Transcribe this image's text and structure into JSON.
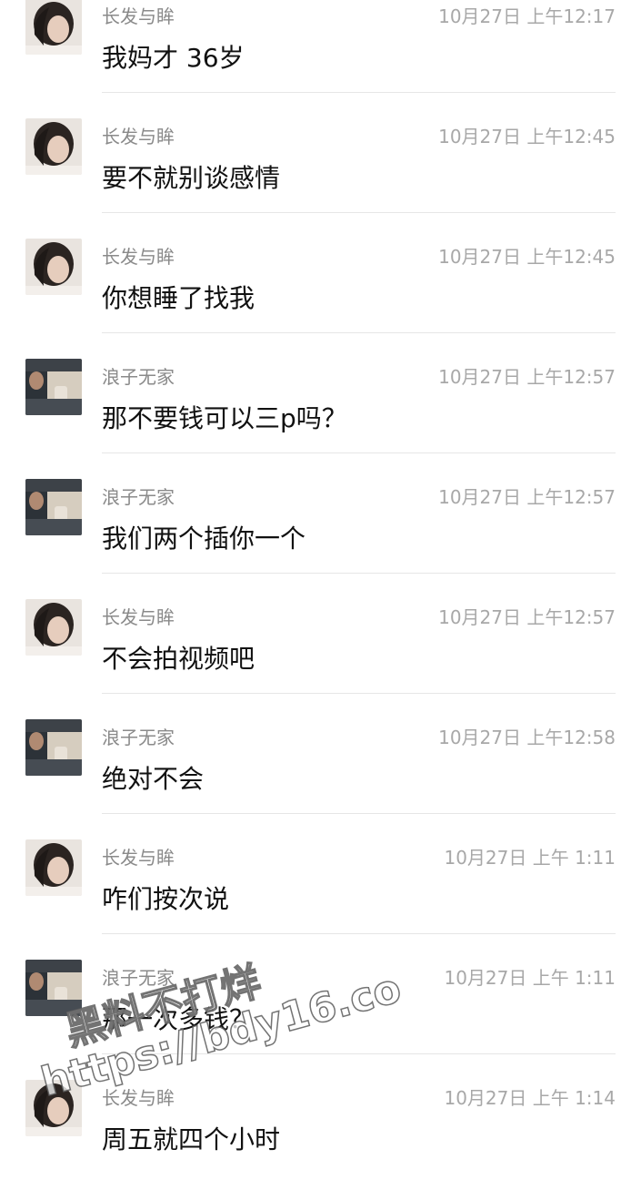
{
  "users": {
    "a": {
      "name": "长发与眸",
      "avatar_icon": "woman-portrait-avatar"
    },
    "b": {
      "name": "浪子无家",
      "avatar_icon": "man-in-car-avatar"
    }
  },
  "messages": [
    {
      "sender": "长发与眸",
      "time": "10月27日 上午12:17",
      "text": "我妈才 36岁"
    },
    {
      "sender": "长发与眸",
      "time": "10月27日 上午12:45",
      "text": "要不就别谈感情"
    },
    {
      "sender": "长发与眸",
      "time": "10月27日 上午12:45",
      "text": "你想睡了找我"
    },
    {
      "sender": "浪子无家",
      "time": "10月27日 上午12:57",
      "text": "那不要钱可以三p吗？"
    },
    {
      "sender": "浪子无家",
      "time": "10月27日 上午12:57",
      "text": "我们两个插你一个"
    },
    {
      "sender": "长发与眸",
      "time": "10月27日 上午12:57",
      "text": "不会拍视频吧"
    },
    {
      "sender": "浪子无家",
      "time": "10月27日 上午12:58",
      "text": "绝对不会"
    },
    {
      "sender": "长发与眸",
      "time": "10月27日 上午 1:11",
      "text": "咋们按次说"
    },
    {
      "sender": "浪子无家",
      "time": "10月27日 上午 1:11",
      "text": "那一次多钱？"
    },
    {
      "sender": "长发与眸",
      "time": "10月27日 上午 1:14",
      "text": "周五就四个小时"
    }
  ],
  "watermark": {
    "line1": "黑料不打烊",
    "line2": "https://bdy16.co"
  },
  "colors": {
    "name": "#8a8a8a",
    "time": "#a8a8a8",
    "message": "#111111",
    "divider": "#e6e6e6"
  }
}
